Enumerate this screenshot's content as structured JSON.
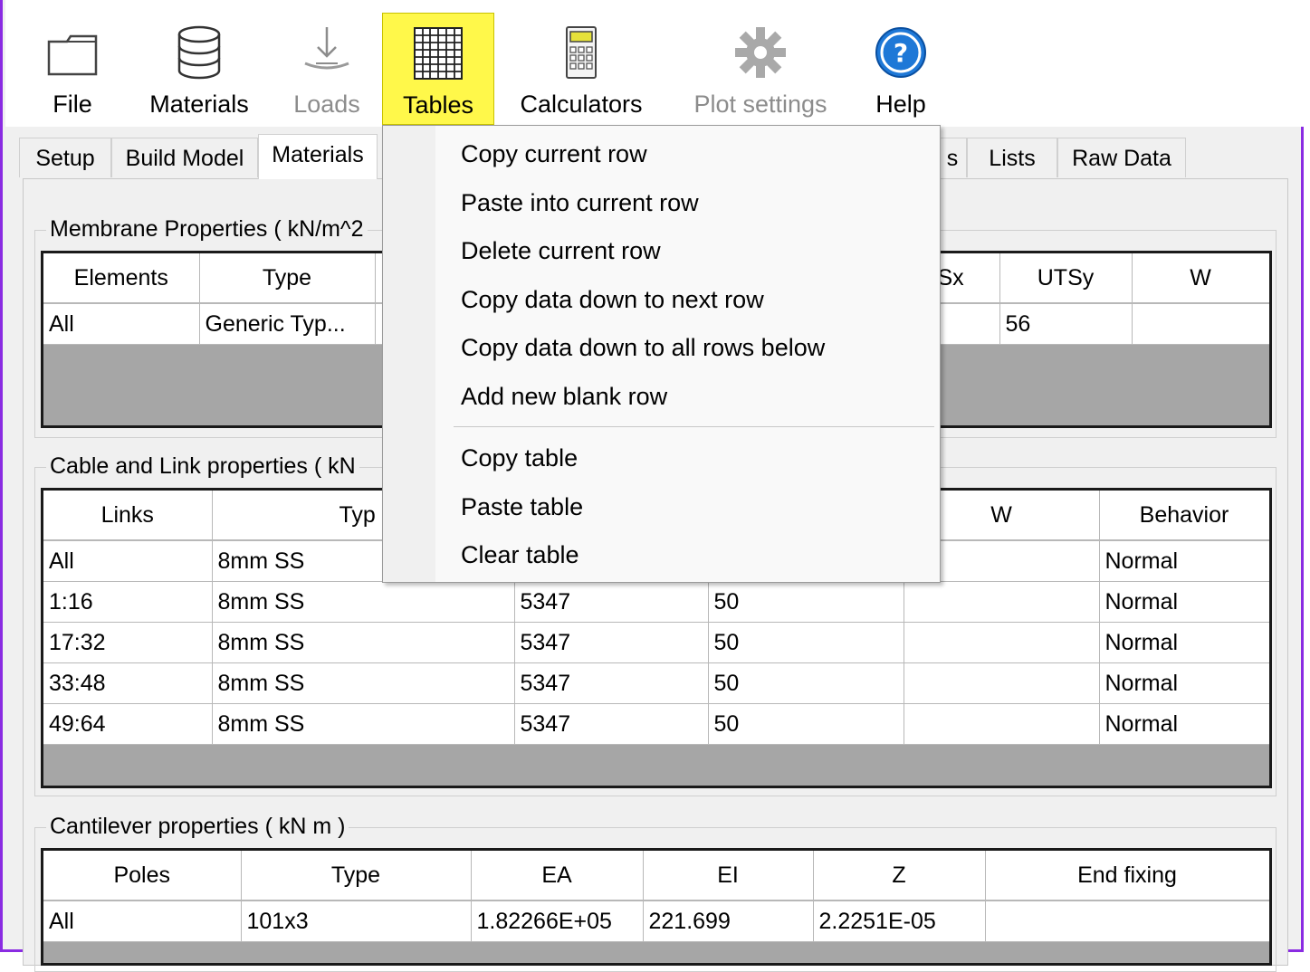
{
  "toolbar": {
    "items": [
      {
        "label": "File",
        "icon": "folder-icon"
      },
      {
        "label": "Materials",
        "icon": "database-icon"
      },
      {
        "label": "Loads",
        "icon": "load-arrow-icon",
        "disabled": true
      },
      {
        "label": "Tables",
        "icon": "grid-table-icon",
        "active": true
      },
      {
        "label": "Calculators",
        "icon": "calculator-icon"
      },
      {
        "label": "Plot settings",
        "icon": "gear-icon",
        "disabled": true
      },
      {
        "label": "Help",
        "icon": "help-circle-icon"
      }
    ]
  },
  "tabs": {
    "setup": "Setup",
    "build_model": "Build Model",
    "materials": "Materials",
    "hidden_suffix": "s",
    "lists": "Lists",
    "raw_data": "Raw Data"
  },
  "membrane": {
    "title": "Membrane Properties ( kN/m^2",
    "headers": {
      "elements": "Elements",
      "type": "Type",
      "utsx_partial": "Sx",
      "utsy": "UTSy",
      "w": "W"
    },
    "rows": [
      {
        "elements": "All",
        "type": "Generic Typ...",
        "utsy": "56",
        "w": ""
      }
    ]
  },
  "cable": {
    "title": "Cable and Link properties ( kN",
    "headers": {
      "links": "Links",
      "type": "Typ",
      "w": "W",
      "behavior": "Behavior"
    },
    "rows": [
      {
        "links": "All",
        "type": "8mm SS",
        "ea": "",
        "c4": "",
        "w": "",
        "behavior": "Normal"
      },
      {
        "links": "1:16",
        "type": "8mm SS",
        "ea": "5347",
        "c4": "50",
        "w": "",
        "behavior": "Normal"
      },
      {
        "links": "17:32",
        "type": "8mm SS",
        "ea": "5347",
        "c4": "50",
        "w": "",
        "behavior": "Normal"
      },
      {
        "links": "33:48",
        "type": "8mm SS",
        "ea": "5347",
        "c4": "50",
        "w": "",
        "behavior": "Normal"
      },
      {
        "links": "49:64",
        "type": "8mm SS",
        "ea": "5347",
        "c4": "50",
        "w": "",
        "behavior": "Normal"
      }
    ]
  },
  "cantilever": {
    "title": "Cantilever properties ( kN m )",
    "headers": {
      "poles": "Poles",
      "type": "Type",
      "ea": "EA",
      "ei": "EI",
      "z": "Z",
      "end_fixing": "End fixing"
    },
    "rows": [
      {
        "poles": "All",
        "type": "101x3",
        "ea": "1.82266E+05",
        "ei": "221.699",
        "z": "2.2251E-05",
        "end_fixing": ""
      }
    ]
  },
  "menu": {
    "items": [
      "Copy current row",
      "Paste into current row",
      "Delete current row",
      "Copy data down to next row",
      "Copy data down to all rows below",
      "Add new blank row",
      "Copy table",
      "Paste table",
      "Clear table"
    ]
  },
  "colors": {
    "active_tool": "#fff84a",
    "window_border": "#8a2be2",
    "help_blue": "#1e78d7"
  }
}
